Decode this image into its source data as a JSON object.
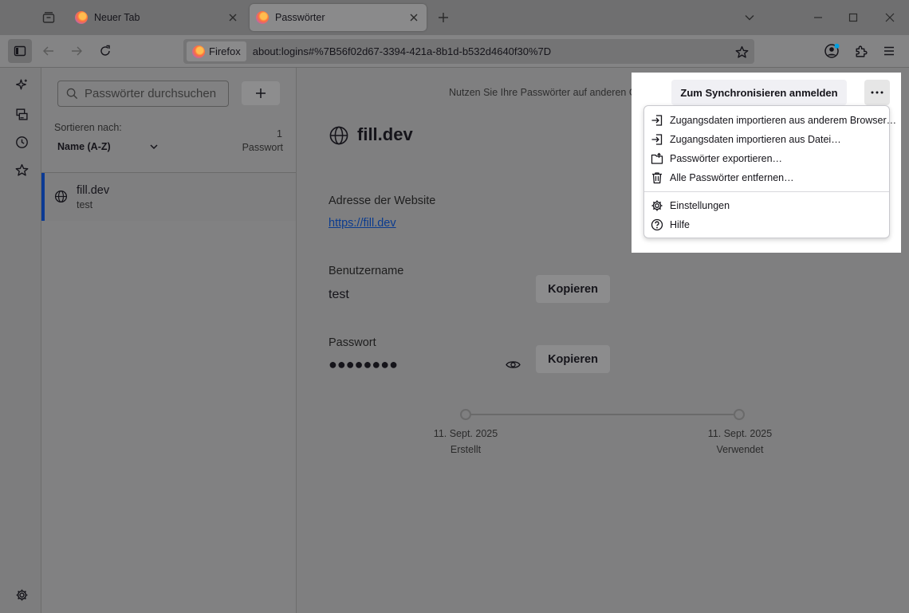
{
  "browser": {
    "tabs": [
      {
        "label": "Neuer Tab",
        "active": false
      },
      {
        "label": "Passwörter",
        "active": true
      }
    ],
    "identity_label": "Firefox",
    "url": "about:logins#%7B56f02d67-3394-421a-8b1d-b532d4640f30%7D"
  },
  "list": {
    "search_placeholder": "Passwörter durchsuchen",
    "add_label": "+",
    "sort_label": "Sortieren nach:",
    "sort_value": "Name (A-Z)",
    "count": "1",
    "count_unit": "Passwort",
    "entries": [
      {
        "title": "fill.dev",
        "username": "test",
        "selected": true
      }
    ]
  },
  "header": {
    "sync_text": "Nutzen Sie Ihre Passwörter auf anderen Geräten",
    "sync_button": "Zum Synchronisieren anmelden"
  },
  "menu": {
    "items": [
      {
        "label": "Zugangsdaten importieren aus anderem Browser…",
        "icon": "import-icon"
      },
      {
        "label": "Zugangsdaten importieren aus Datei…",
        "icon": "import-icon"
      },
      {
        "label": "Passwörter exportieren…",
        "icon": "export-icon"
      },
      {
        "label": "Alle Passwörter entfernen…",
        "icon": "trash-icon"
      },
      {
        "label": "Einstellungen",
        "icon": "gear-icon"
      },
      {
        "label": "Hilfe",
        "icon": "help-icon"
      }
    ]
  },
  "detail": {
    "title": "fill.dev",
    "website_label": "Adresse der Website",
    "website_value": "https://fill.dev",
    "username_label": "Benutzername",
    "username_value": "test",
    "password_label": "Passwort",
    "password_value": "●●●●●●●●",
    "copy_label": "Kopieren",
    "created_date": "11. Sept. 2025",
    "created_label": "Erstellt",
    "used_date": "11. Sept. 2025",
    "used_label": "Verwendet"
  },
  "colors": {
    "accent": "#0b3a94",
    "link": "#0a3b8f"
  }
}
